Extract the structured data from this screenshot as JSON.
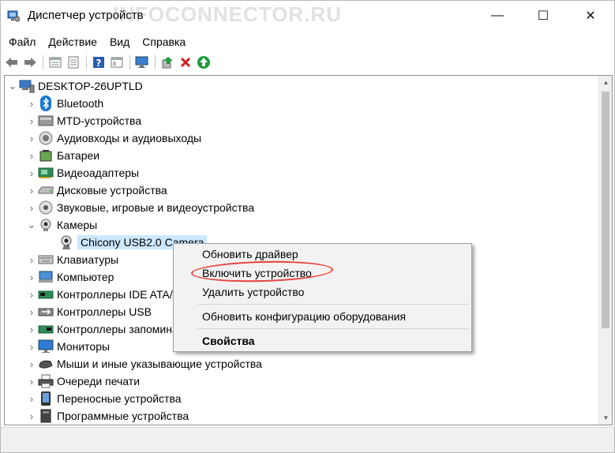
{
  "window": {
    "title": "Диспетчер устройств",
    "watermark": "INFOCONNECTOR.RU",
    "controls": {
      "minimize": "—",
      "maximize": "☐",
      "close": "✕"
    }
  },
  "menu": [
    "Файл",
    "Действие",
    "Вид",
    "Справка"
  ],
  "toolbar": {
    "icons": [
      "back-arrow",
      "forward-arrow",
      "properties-sheet",
      "tree-list",
      "help-question",
      "resources-panel",
      "monitor-scan",
      "update-driver",
      "uninstall-x",
      "enable-device"
    ]
  },
  "tree": {
    "root": "DESKTOP-26UPTLD",
    "items": [
      {
        "label": "Bluetooth",
        "icon": "bluetooth-icon",
        "expanded": false
      },
      {
        "label": "MTD-устройства",
        "icon": "mtd-device-icon",
        "expanded": false
      },
      {
        "label": "Аудиовходы и аудиовыходы",
        "icon": "audio-io-icon",
        "expanded": false
      },
      {
        "label": "Батареи",
        "icon": "battery-icon",
        "expanded": false
      },
      {
        "label": "Видеоадаптеры",
        "icon": "display-adapter-icon",
        "expanded": false
      },
      {
        "label": "Дисковые устройства",
        "icon": "disk-drive-icon",
        "expanded": false
      },
      {
        "label": "Звуковые, игровые и видеоустройства",
        "icon": "sound-icon",
        "expanded": false
      },
      {
        "label": "Камеры",
        "icon": "camera-icon",
        "expanded": true
      },
      {
        "label": "Chicony USB2.0 Camera",
        "icon": "webcam-icon",
        "child": true
      },
      {
        "label": "Клавиатуры",
        "icon": "keyboard-icon",
        "expanded": false
      },
      {
        "label": "Компьютер",
        "icon": "computer-icon",
        "expanded": false
      },
      {
        "label": "Контроллеры IDE ATA/ATAPI",
        "icon": "ide-controller-icon",
        "expanded": false
      },
      {
        "label": "Контроллеры USB",
        "icon": "usb-controller-icon",
        "expanded": false
      },
      {
        "label": "Контроллеры запоминающих устройств",
        "icon": "storage-controller-icon",
        "expanded": false
      },
      {
        "label": "Мониторы",
        "icon": "monitor-icon",
        "expanded": false
      },
      {
        "label": "Мыши и иные указывающие устройства",
        "icon": "mouse-icon",
        "expanded": false
      },
      {
        "label": "Очереди печати",
        "icon": "printer-icon",
        "expanded": false
      },
      {
        "label": "Переносные устройства",
        "icon": "portable-device-icon",
        "expanded": false
      },
      {
        "label": "Программные устройства",
        "icon": "software-device-icon",
        "expanded": false
      }
    ]
  },
  "context_menu": {
    "items": [
      {
        "label": "Обновить драйвер"
      },
      {
        "label": "Включить устройство",
        "highlighted": true
      },
      {
        "label": "Удалить устройство"
      },
      {
        "label": "Обновить конфигурацию оборудования"
      },
      {
        "label": "Свойства",
        "bold": true
      }
    ],
    "highlight_color": "#e8413a"
  },
  "colors": {
    "selection": "#cce8ff",
    "menu_bg": "#f2f2f2",
    "enable_green": "#1a9b3a",
    "uninstall_red": "#d21f1f"
  }
}
